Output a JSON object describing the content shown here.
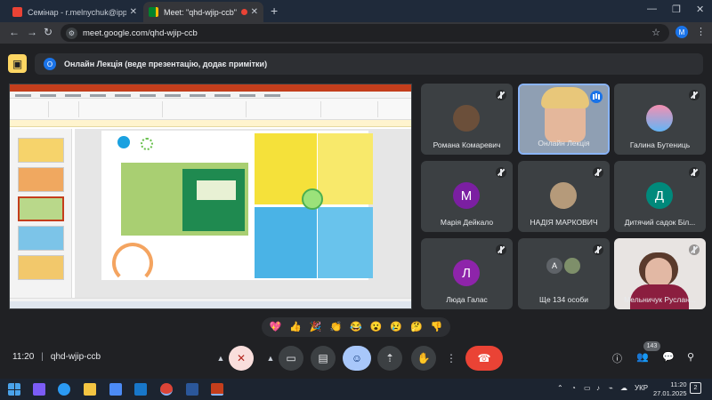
{
  "browser": {
    "tabs": [
      {
        "title": "Семінар - r.melnychuk@ippo...",
        "active": false
      },
      {
        "title": "Meet: \"qhd-wjip-ccb\"",
        "active": true
      }
    ],
    "url": "meet.google.com/qhd-wjip-ccb",
    "profile_initial": "M"
  },
  "meet": {
    "presenter_initial": "О",
    "presenter_banner": "Онлайн Лекція (веде презентацію, додає примітки)",
    "participants": [
      {
        "name": "Романа Комаревич",
        "kind": "photo",
        "muted": true
      },
      {
        "name": "Онлайн Лекція",
        "kind": "video",
        "muted": false,
        "speaking": true
      },
      {
        "name": "Галина Бутениць",
        "kind": "photo",
        "muted": true
      },
      {
        "name": "Марія Дейкало",
        "kind": "initial",
        "initial": "М",
        "color": "#7b1fa2",
        "muted": true
      },
      {
        "name": "НАДІЯ МАРКОВИЧ",
        "kind": "photo",
        "muted": true
      },
      {
        "name": "Дитячий садок Біл...",
        "kind": "initial",
        "initial": "Д",
        "color": "#00897b",
        "muted": true
      },
      {
        "name": "Люда Галас",
        "kind": "initial",
        "initial": "Л",
        "color": "#8e24aa",
        "muted": true
      },
      {
        "name": "Ще 134 особи",
        "kind": "group",
        "initial": "А",
        "muted": true
      },
      {
        "name": "Мельничук Руслан...",
        "kind": "video",
        "muted": true
      }
    ],
    "reactions": [
      "💖",
      "👍",
      "🎉",
      "👏",
      "😂",
      "😮",
      "😢",
      "🤔",
      "👎"
    ],
    "time": "11:20",
    "meeting_code": "qhd-wjip-ccb",
    "people_count": "143"
  },
  "taskbar": {
    "lang": "УКР",
    "clock_time": "11:20",
    "clock_date": "27.01.2025",
    "notification_count": "2"
  }
}
